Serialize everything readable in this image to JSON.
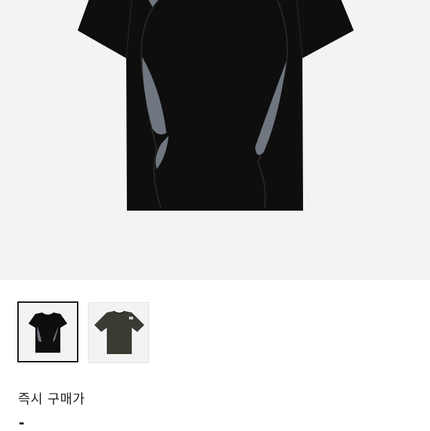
{
  "product": {
    "main_image": "black-panel-tshirt-image",
    "thumbnails": [
      {
        "image": "black-tshirt-thumbnail",
        "selected": true
      },
      {
        "image": "olive-tshirt-thumbnail",
        "selected": false
      }
    ]
  },
  "price": {
    "label": "즉시 구매가",
    "value": "-"
  },
  "colors": {
    "shirt_black": "#0e0e0e",
    "panel_gray": "#6f7680",
    "shirt_olive": "#3a3b33",
    "selected_border": "#111111",
    "hero_bg": "#f3f3f3"
  }
}
